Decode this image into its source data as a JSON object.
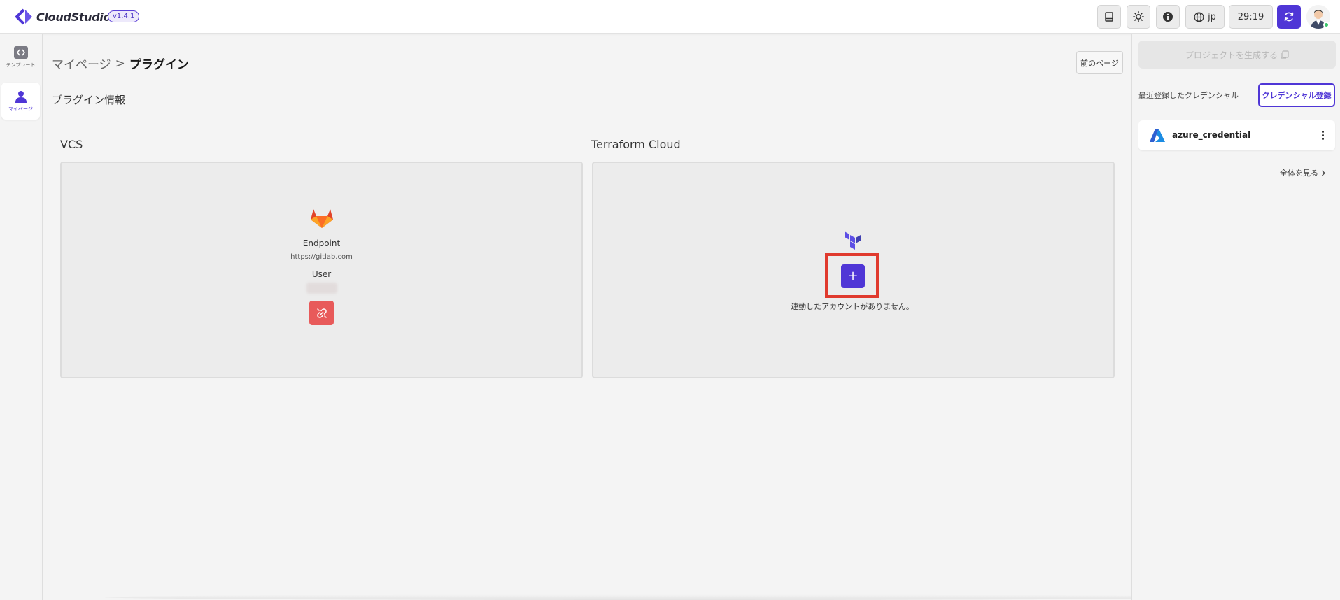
{
  "app": {
    "name": "CloudStudio",
    "version": "v1.4.1"
  },
  "header": {
    "language": "jp",
    "timer": "29:19"
  },
  "leftnav": {
    "items": [
      {
        "label": "テンプレート"
      },
      {
        "label": "マイページ"
      }
    ]
  },
  "breadcrumb": {
    "parent": "マイページ",
    "separator": ">",
    "current": "プラグイン"
  },
  "back_button": "前のページ",
  "section_title": "プラグイン情報",
  "vcs": {
    "title": "VCS",
    "endpoint_label": "Endpoint",
    "endpoint_value": "https://gitlab.com",
    "user_label": "User"
  },
  "terraform": {
    "title": "Terraform Cloud",
    "add_label": "+",
    "empty_message": "連動したアカウントがありません。"
  },
  "rightpanel": {
    "create_project": "プロジェクトを生成する",
    "recent_label": "最近登録したクレデンシャル",
    "register_button": "クレデンシャル登録",
    "credentials": [
      {
        "name": "azure_credential"
      }
    ],
    "see_all": "全体を見る"
  },
  "colors": {
    "accent": "#4f36d6",
    "danger": "#e85a5a",
    "highlight": "#e03a2e"
  }
}
